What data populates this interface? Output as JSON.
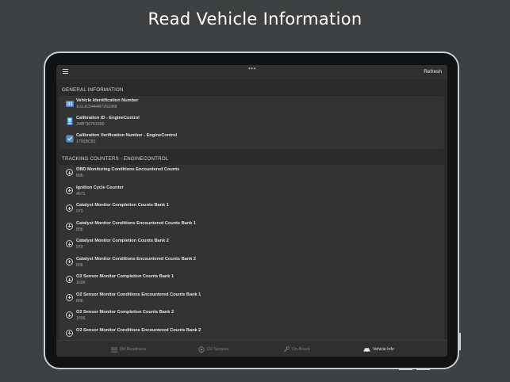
{
  "headline": "Read Vehicle Information",
  "topbar": {
    "dots": "•••",
    "refresh_label": "Refresh"
  },
  "sections": {
    "general": {
      "title": "GENERAL INFORMATION",
      "items": [
        {
          "label": "Vehicle Identification Number",
          "value": "1G1JC5444R7252368",
          "icon": "barcode-icon"
        },
        {
          "label": "Calibration ID - EngineControl",
          "value": "JMB*36761500",
          "icon": "id-card-icon"
        },
        {
          "label": "Calibration Verification Number - EngineControl",
          "value": "1791BC82",
          "icon": "verify-chip-icon"
        }
      ]
    },
    "tracking": {
      "title": "TRACKING COUNTERS - ENGINECONTROL",
      "items": [
        {
          "label": "OBD Monitoring Conditions Encountered Counts",
          "value": "806"
        },
        {
          "label": "Ignition Cycle Counter",
          "value": "4671"
        },
        {
          "label": "Catalyst Monitor Completion Counts Bank 1",
          "value": "970"
        },
        {
          "label": "Catalyst Monitor Conditions Encountered Counts Bank 1",
          "value": "806"
        },
        {
          "label": "Catalyst Monitor Completion Counts Bank 2",
          "value": "970"
        },
        {
          "label": "Catalyst Monitor Conditions Encountered Counts Bank 2",
          "value": "806"
        },
        {
          "label": "O2 Sensor Monitor Completion Counts Bank 1",
          "value": "1696"
        },
        {
          "label": "O2 Sensor Monitor Conditions Encountered Counts Bank 1",
          "value": "806"
        },
        {
          "label": "O2 Sensor Monitor Completion Counts Bank 2",
          "value": "1696"
        },
        {
          "label": "O2 Sensor Monitor Conditions Encountered Counts Bank 2",
          "value": ""
        }
      ]
    }
  },
  "tabs": [
    {
      "label": "I/M Readiness",
      "icon": "list-icon",
      "active": false
    },
    {
      "label": "O2 Sensors",
      "icon": "sensor-icon",
      "active": false
    },
    {
      "label": "On-Board",
      "icon": "wrench-icon",
      "active": false
    },
    {
      "label": "Vehicle Info",
      "icon": "car-icon",
      "active": true
    }
  ],
  "colors": {
    "background": "#3e4042",
    "screen": "#2a2a2b",
    "card": "#333334",
    "active_tab": "#e0e0e0"
  }
}
